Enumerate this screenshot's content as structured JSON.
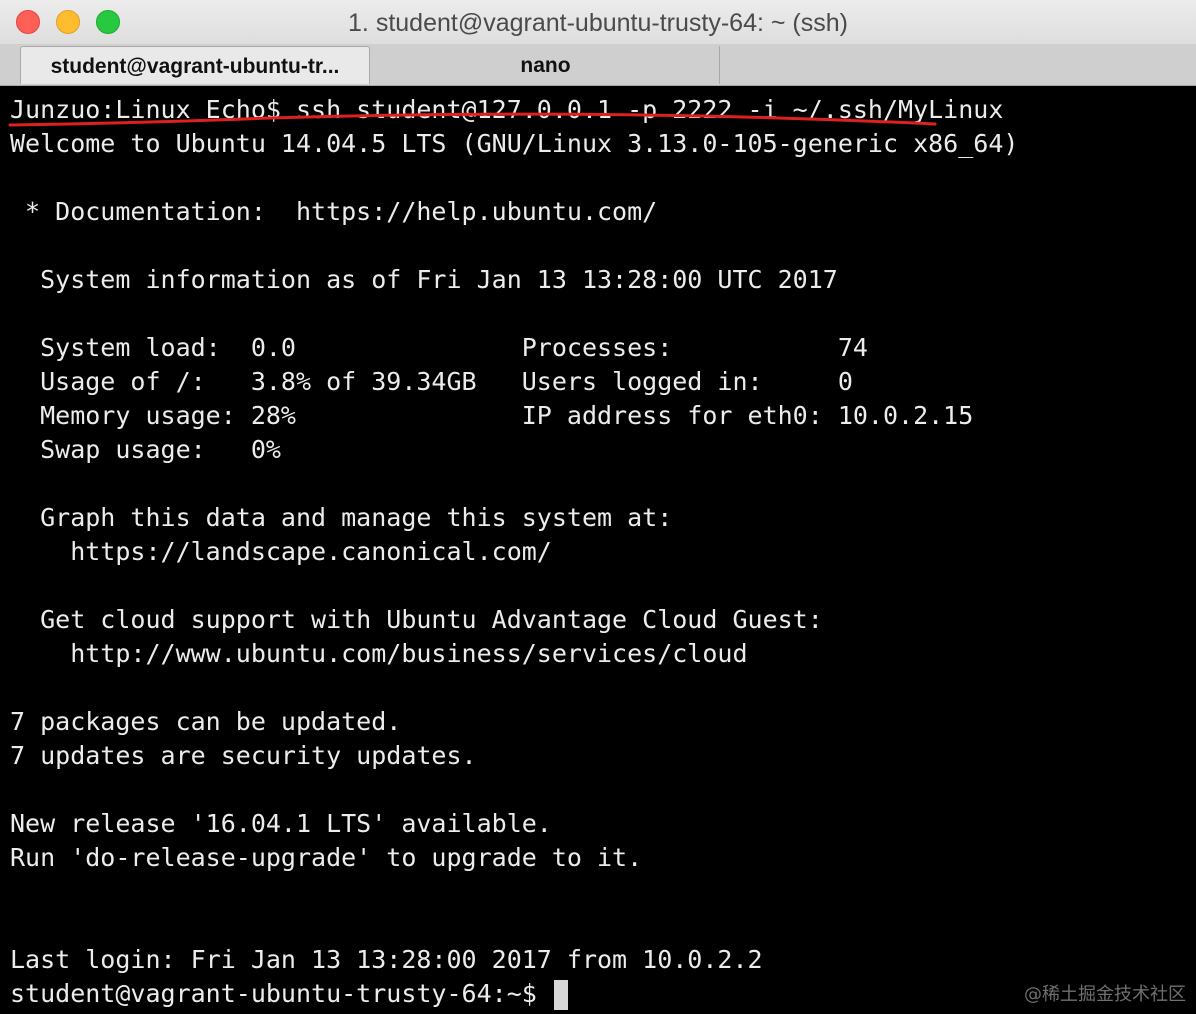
{
  "window": {
    "title": "1. student@vagrant-ubuntu-trusty-64: ~ (ssh)"
  },
  "tabs": [
    {
      "label": "student@vagrant-ubuntu-tr...",
      "active": true
    },
    {
      "label": "nano",
      "active": false
    }
  ],
  "terminal": {
    "lines": [
      "Junzuo:Linux Echo$ ssh student@127.0.0.1 -p 2222 -i ~/.ssh/MyLinux",
      "Welcome to Ubuntu 14.04.5 LTS (GNU/Linux 3.13.0-105-generic x86_64)",
      "",
      " * Documentation:  https://help.ubuntu.com/",
      "",
      "  System information as of Fri Jan 13 13:28:00 UTC 2017",
      "",
      "  System load:  0.0               Processes:           74",
      "  Usage of /:   3.8% of 39.34GB   Users logged in:     0",
      "  Memory usage: 28%               IP address for eth0: 10.0.2.15",
      "  Swap usage:   0%",
      "",
      "  Graph this data and manage this system at:",
      "    https://landscape.canonical.com/",
      "",
      "  Get cloud support with Ubuntu Advantage Cloud Guest:",
      "    http://www.ubuntu.com/business/services/cloud",
      "",
      "7 packages can be updated.",
      "7 updates are security updates.",
      "",
      "New release '16.04.1 LTS' available.",
      "Run 'do-release-upgrade' to upgrade to it.",
      "",
      "",
      "Last login: Fri Jan 13 13:28:00 2017 from 10.0.2.2"
    ],
    "prompt": "student@vagrant-ubuntu-trusty-64:~$ "
  },
  "annotation": {
    "color": "#e02020"
  },
  "watermark": "@稀土掘金技术社区",
  "colors": {
    "terminal_bg": "#000000",
    "terminal_fg": "#ececec"
  }
}
